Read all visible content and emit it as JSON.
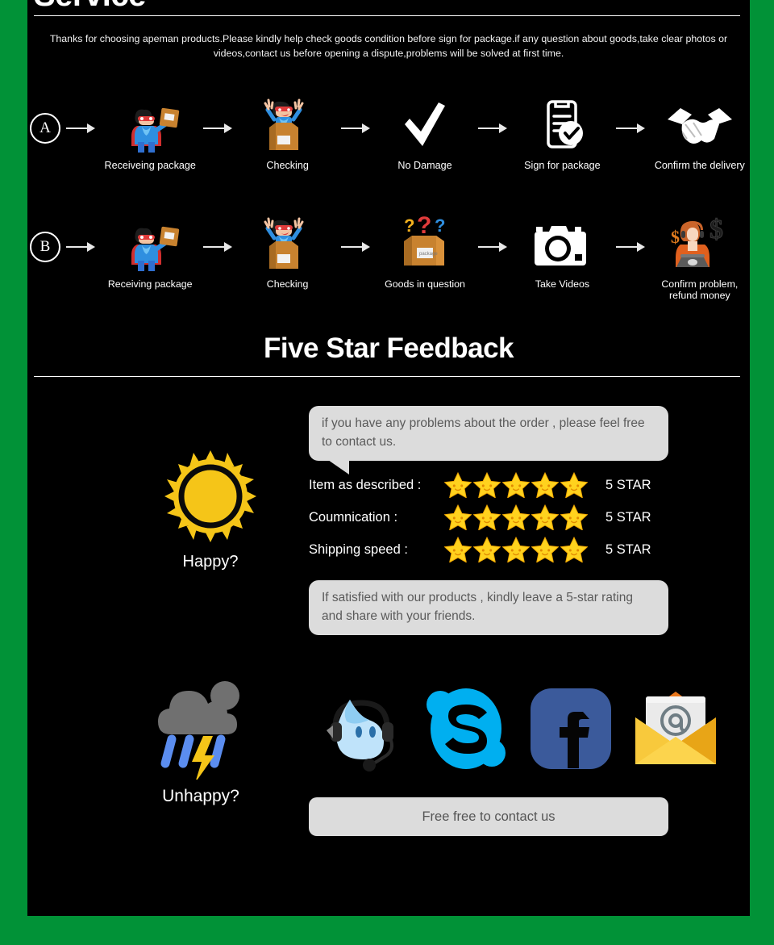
{
  "theme": {
    "frame_green": "#019237",
    "panel_bg": "#000000",
    "text_white": "#ffffff",
    "bubble_gray": "#dcdcdc",
    "bubble_text": "#5a5a5a",
    "star_yellow": "#ffd21e",
    "rain_blue": "#5b8def",
    "cloud_gray": "#707070"
  },
  "header": {
    "title": "Service",
    "intro": "Thanks for choosing apeman products.Please kindly help check goods condition before sign for package.if any question about goods,take clear photos or videos,contact us before opening a dispute,problems will be solved at first time."
  },
  "flows": [
    {
      "badge": "A",
      "steps": [
        {
          "icon": "superhero-package-icon",
          "label": "Receiveing package"
        },
        {
          "icon": "open-box-happy-icon",
          "label": "Checking"
        },
        {
          "icon": "checkmark-icon",
          "label": "No Damage"
        },
        {
          "icon": "clipboard-check-icon",
          "label": "Sign for package"
        },
        {
          "icon": "handshake-icon",
          "label": "Confirm the delivery"
        }
      ]
    },
    {
      "badge": "B",
      "steps": [
        {
          "icon": "superhero-package-icon",
          "label": "Receiving package"
        },
        {
          "icon": "open-box-happy-icon",
          "label": "Checking"
        },
        {
          "icon": "box-question-marks-icon",
          "label": "Goods in question"
        },
        {
          "icon": "camera-icon",
          "label": "Take Videos"
        },
        {
          "icon": "support-agent-money-icon",
          "label": "Confirm problem, refund money"
        }
      ]
    }
  ],
  "feedback": {
    "section_title": "Five Star Feedback",
    "bubble_top": "if you have any problems about the order , please feel free to contact us.",
    "bubble_bottom": "If satisfied with our products , kindly leave a 5-star rating and share with your friends.",
    "ratings": [
      {
        "label": "Item as described :",
        "stars": 5,
        "value": "5 STAR"
      },
      {
        "label": "Coumnication :",
        "stars": 5,
        "value": "5 STAR"
      },
      {
        "label": "Shipping speed :",
        "stars": 5,
        "value": "5 STAR"
      }
    ],
    "moods": [
      {
        "icon": "sun-icon",
        "label": "Happy?"
      },
      {
        "icon": "rain-cloud-lightning-icon",
        "label": "Unhappy?"
      }
    ]
  },
  "contact": {
    "channels": [
      {
        "icon": "alitalk-icon",
        "name": "AliTalk"
      },
      {
        "icon": "skype-icon",
        "name": "Skype"
      },
      {
        "icon": "facebook-icon",
        "name": "Facebook"
      },
      {
        "icon": "email-envelope-icon",
        "name": "Email"
      }
    ],
    "cta": "Free free to contact us"
  }
}
